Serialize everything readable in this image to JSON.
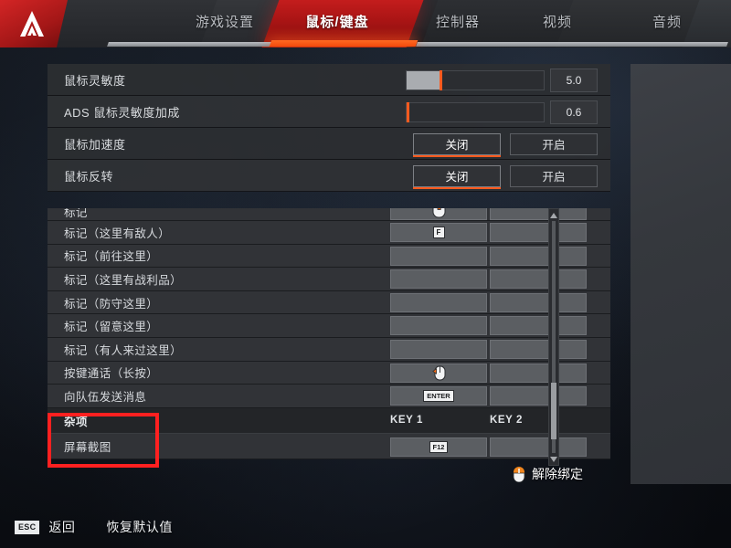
{
  "header": {
    "logo_icon": "apex-legends-logo",
    "tabs": [
      {
        "label": "游戏设置",
        "active": false
      },
      {
        "label": "鼠标/键盘",
        "active": true
      },
      {
        "label": "控制器",
        "active": false
      },
      {
        "label": "视频",
        "active": false
      },
      {
        "label": "音频",
        "active": false
      }
    ]
  },
  "settings": {
    "rows": [
      {
        "label": "鼠标灵敏度",
        "type": "slider",
        "value": "5.0",
        "fill_pct": 24,
        "handle_pct": 24
      },
      {
        "label": "ADS 鼠标灵敏度加成",
        "type": "slider",
        "value": "0.6",
        "fill_pct": 0,
        "handle_pct": 0
      },
      {
        "label": "鼠标加速度",
        "type": "toggle",
        "off_label": "关闭",
        "on_label": "开启",
        "selected": "关闭"
      },
      {
        "label": "鼠标反转",
        "type": "toggle",
        "off_label": "关闭",
        "on_label": "开启",
        "selected": "关闭"
      }
    ]
  },
  "keybinds": {
    "column_headers": {
      "key1": "KEY 1",
      "key2": "KEY 2"
    },
    "rows": [
      {
        "label": "标记",
        "key1": "mouse-middle-icon",
        "key2": "",
        "clipped": true
      },
      {
        "label": "标记（这里有敌人）",
        "key1": "F",
        "key2": ""
      },
      {
        "label": "标记（前往这里）",
        "key1": "",
        "key2": ""
      },
      {
        "label": "标记（这里有战利品）",
        "key1": "",
        "key2": ""
      },
      {
        "label": "标记（防守这里）",
        "key1": "",
        "key2": ""
      },
      {
        "label": "标记（留意这里）",
        "key1": "",
        "key2": ""
      },
      {
        "label": "标记（有人来过这里）",
        "key1": "",
        "key2": ""
      },
      {
        "label": "按键通话（长按）",
        "key1": "mouse-side-icon",
        "key2": ""
      },
      {
        "label": "向队伍发送消息",
        "key1": "ENTER",
        "key2": ""
      }
    ],
    "section": {
      "label": "杂项"
    },
    "section_rows": [
      {
        "label": "屏幕截图",
        "key1": "F12",
        "key2": ""
      }
    ],
    "scrollbar": {
      "up_icon": "caret-up-icon",
      "down_icon": "caret-down-icon",
      "thumb_pct": 72
    }
  },
  "footer": {
    "unbind_label": "解除绑定",
    "unbind_icon": "mouse-unbind-icon",
    "esc_key": "ESC",
    "back_label": "返回",
    "reset_label": "恢复默认值"
  },
  "colors": {
    "accent_orange": "#ff5a1e",
    "brand_red": "#c41d1d",
    "annotation_red": "#ff2020",
    "panel_bg": "#2f3135"
  }
}
